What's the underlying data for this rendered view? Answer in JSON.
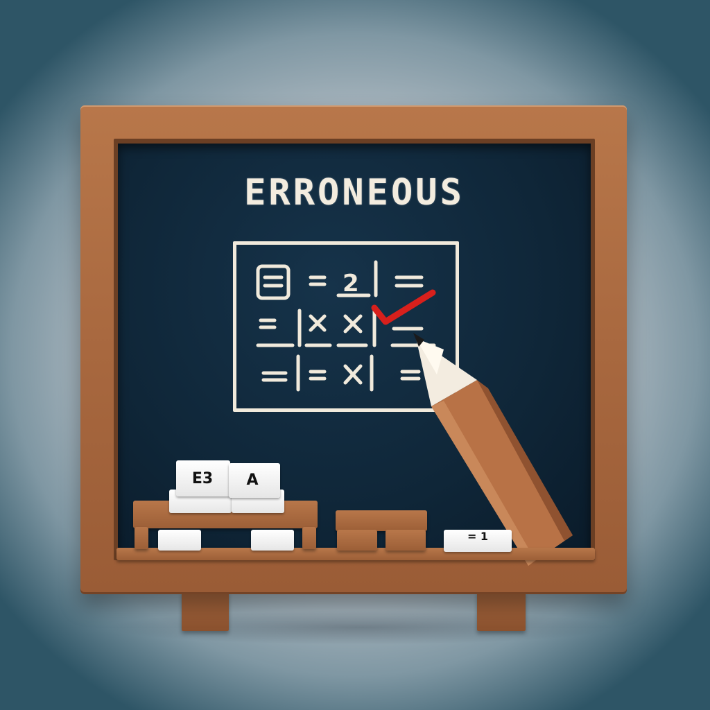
{
  "board": {
    "title": "ERRONEOUS"
  },
  "blocks": {
    "cube_left_label": "E3",
    "cube_right_label": "A",
    "tile_label": "= 1"
  },
  "colors": {
    "frame_wood": "#a8683f",
    "chalkboard": "#0f2638",
    "chalk": "#f1eadc",
    "checkmark": "#d8201c"
  },
  "icons": {
    "checkmark": "red-checkmark-icon",
    "pencil": "pencil-icon",
    "cross": "x-mark-icon"
  }
}
